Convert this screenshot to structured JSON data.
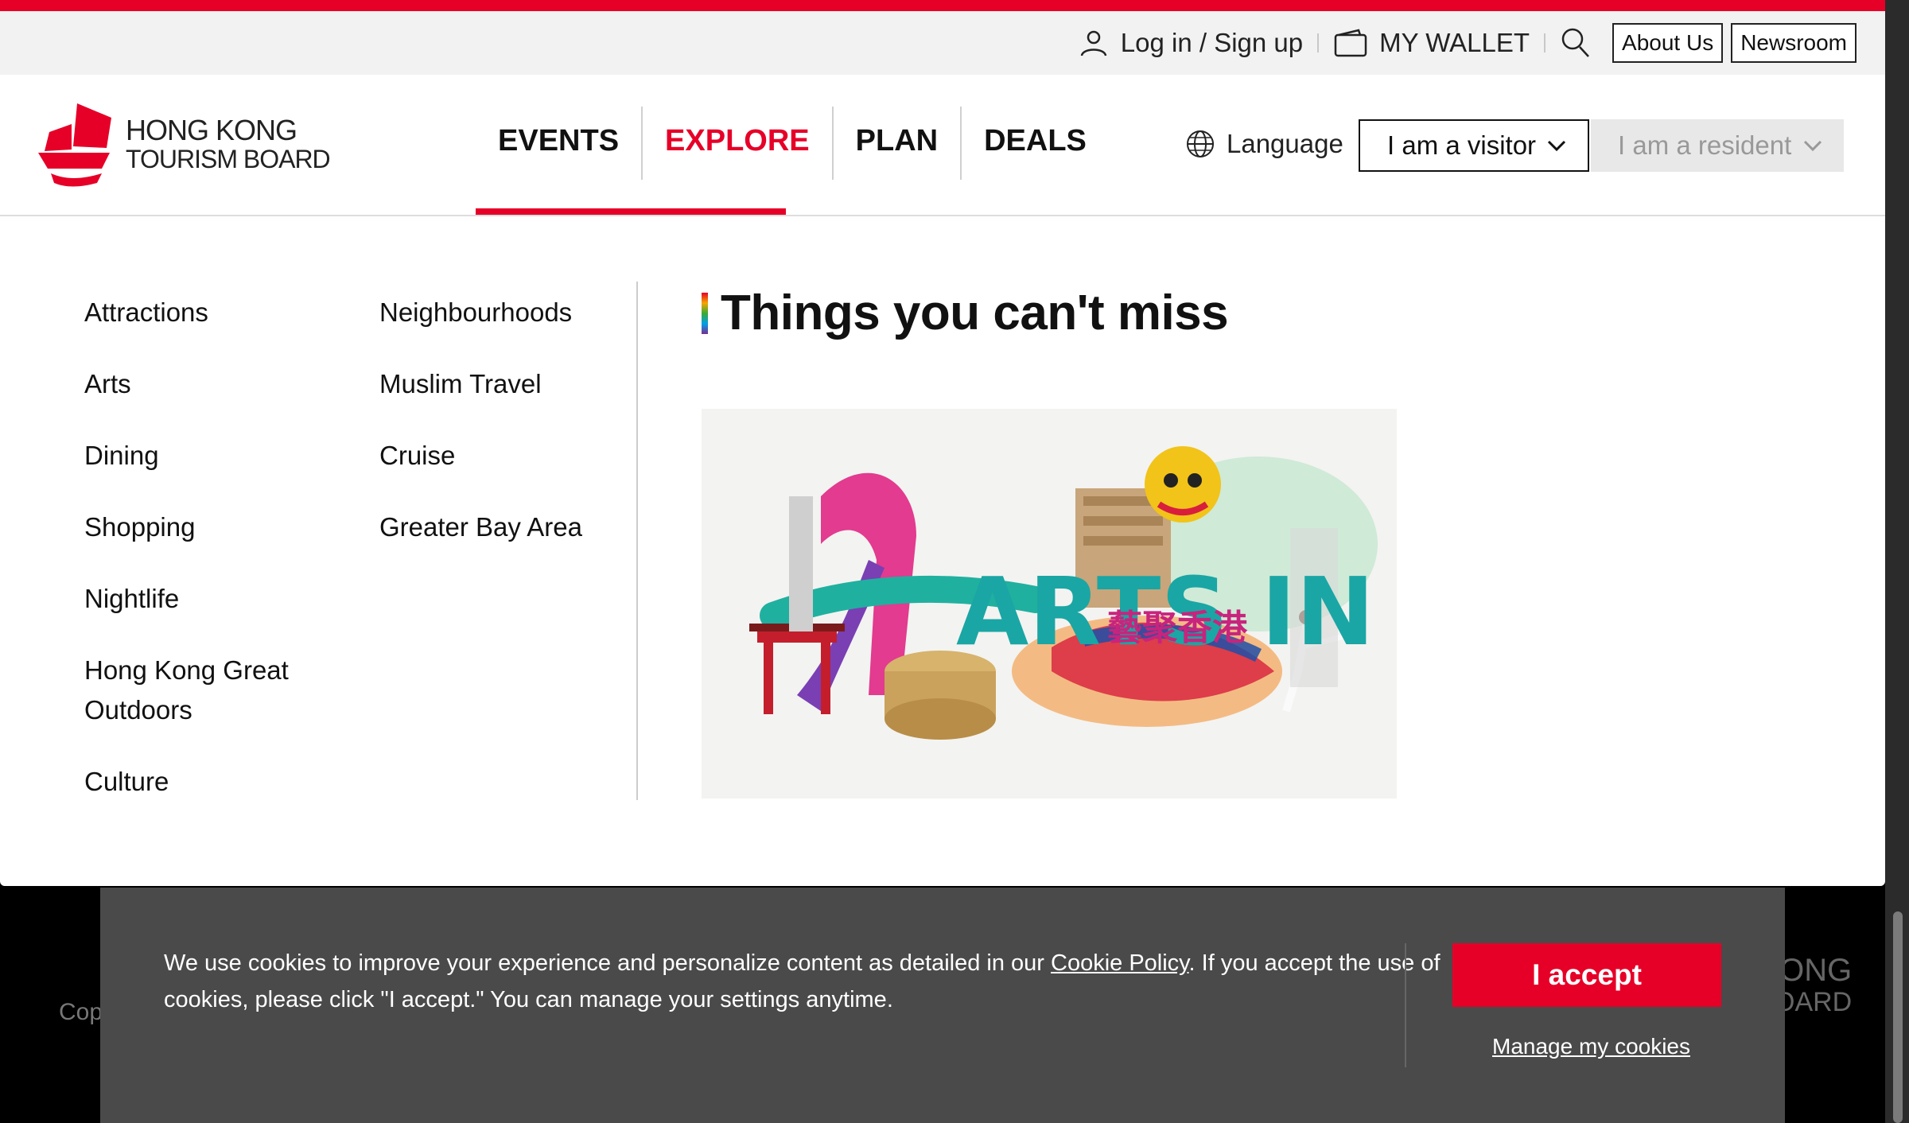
{
  "utility": {
    "login_label": "Log in / Sign up",
    "wallet_label": "MY WALLET",
    "about_label": "About Us",
    "newsroom_label": "Newsroom"
  },
  "logo": {
    "line1": "HONG KONG",
    "line2": "TOURISM BOARD"
  },
  "nav": {
    "items": [
      {
        "label": "EVENTS"
      },
      {
        "label": "EXPLORE"
      },
      {
        "label": "PLAN"
      },
      {
        "label": "DEALS"
      }
    ],
    "active": "EXPLORE"
  },
  "language_label": "Language",
  "visitor_select": "I am a visitor",
  "resident_select": "I am a resident",
  "menu": {
    "col1": [
      "Attractions",
      "Arts",
      "Dining",
      "Shopping",
      "Nightlife",
      "Hong Kong Great Outdoors",
      "Culture"
    ],
    "col2": [
      "Neighbourhoods",
      "Muslim Travel",
      "Cruise",
      "Greater Bay Area"
    ]
  },
  "feature": {
    "title": "Things you can't miss",
    "image_text": "ARTS IN HK",
    "image_text_cn": "藝聚香港"
  },
  "footer": {
    "copy_fragment": "Cop",
    "logo_fragment_1": "ONG",
    "logo_fragment_2": "OARD"
  },
  "cookie": {
    "text_before": "We use cookies to improve your experience and personalize content as detailed in our ",
    "policy_link": "Cookie Policy",
    "text_after": ". If you accept the use of cookies, please click \"I accept.\" You can manage your settings anytime.",
    "accept_label": "I accept",
    "manage_label": "Manage my cookies"
  },
  "colors": {
    "brand_red": "#e60028",
    "cookie_bg": "#4a4a4a"
  }
}
